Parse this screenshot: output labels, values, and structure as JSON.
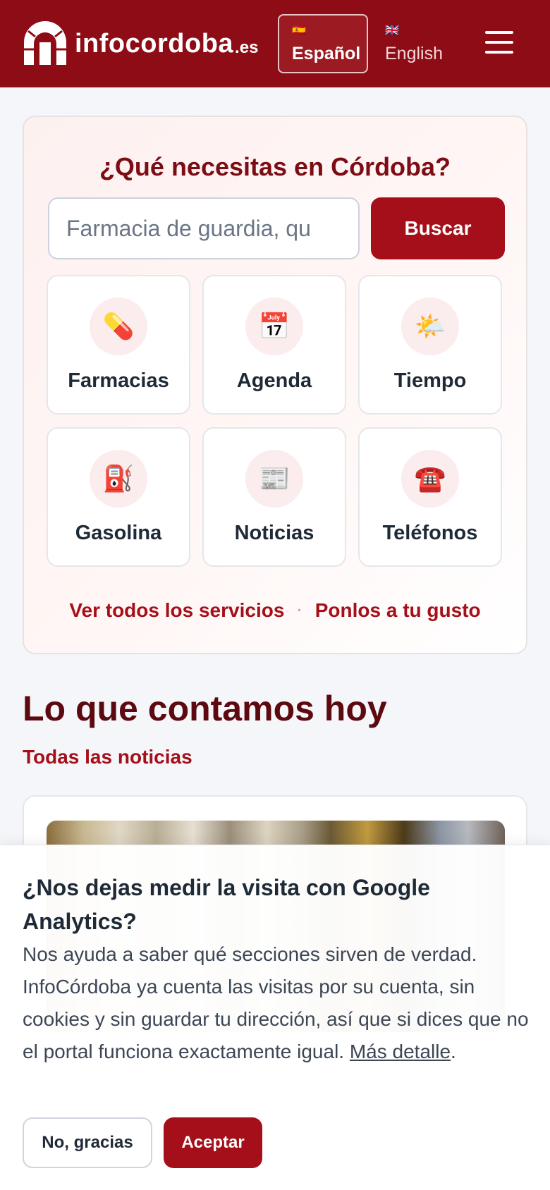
{
  "header": {
    "logo_text": "infocordoba",
    "logo_tld": ".es",
    "languages": [
      {
        "flag": "🇪🇸",
        "label": "Español",
        "active": true
      },
      {
        "flag": "🇬🇧",
        "label": "English",
        "active": false
      }
    ],
    "menu_icon": "hamburger-menu-icon"
  },
  "services": {
    "title": "¿Qué necesitas en Córdoba?",
    "search_placeholder": "Farmacia de guardia, qu",
    "search_button": "Buscar",
    "tiles": [
      {
        "label": "Farmacias",
        "icon": "💊",
        "icon_name": "pill-icon"
      },
      {
        "label": "Agenda",
        "icon": "📅",
        "icon_name": "calendar-icon"
      },
      {
        "label": "Tiempo",
        "icon": "🌤️",
        "icon_name": "weather-icon"
      },
      {
        "label": "Gasolina",
        "icon": "⛽",
        "icon_name": "fuel-pump-icon"
      },
      {
        "label": "Noticias",
        "icon": "📰",
        "icon_name": "newspaper-icon"
      },
      {
        "label": "Teléfonos",
        "icon": "☎️",
        "icon_name": "telephone-icon"
      }
    ],
    "link_all": "Ver todos los servicios",
    "link_separator": "·",
    "link_customize": "Ponlos a tu gusto"
  },
  "news": {
    "title": "Lo que contamos hoy",
    "all_link": "Todas las noticias"
  },
  "cookie": {
    "title": "¿Nos dejas medir la visita con Google Analytics?",
    "text": "Nos ayuda a saber qué secciones sirven de verdad. InfoCórdoba ya cuenta las visitas por su cuenta, sin cookies y sin guardar tu dirección, así que si dices que no el portal funciona exactamente igual.",
    "more_link": "Más detalle",
    "text_end": ".",
    "decline": "No, gracias",
    "accept": "Aceptar"
  },
  "colors": {
    "brand": "#8e0c15",
    "accent": "#a40f19",
    "title": "#7d0d15"
  }
}
